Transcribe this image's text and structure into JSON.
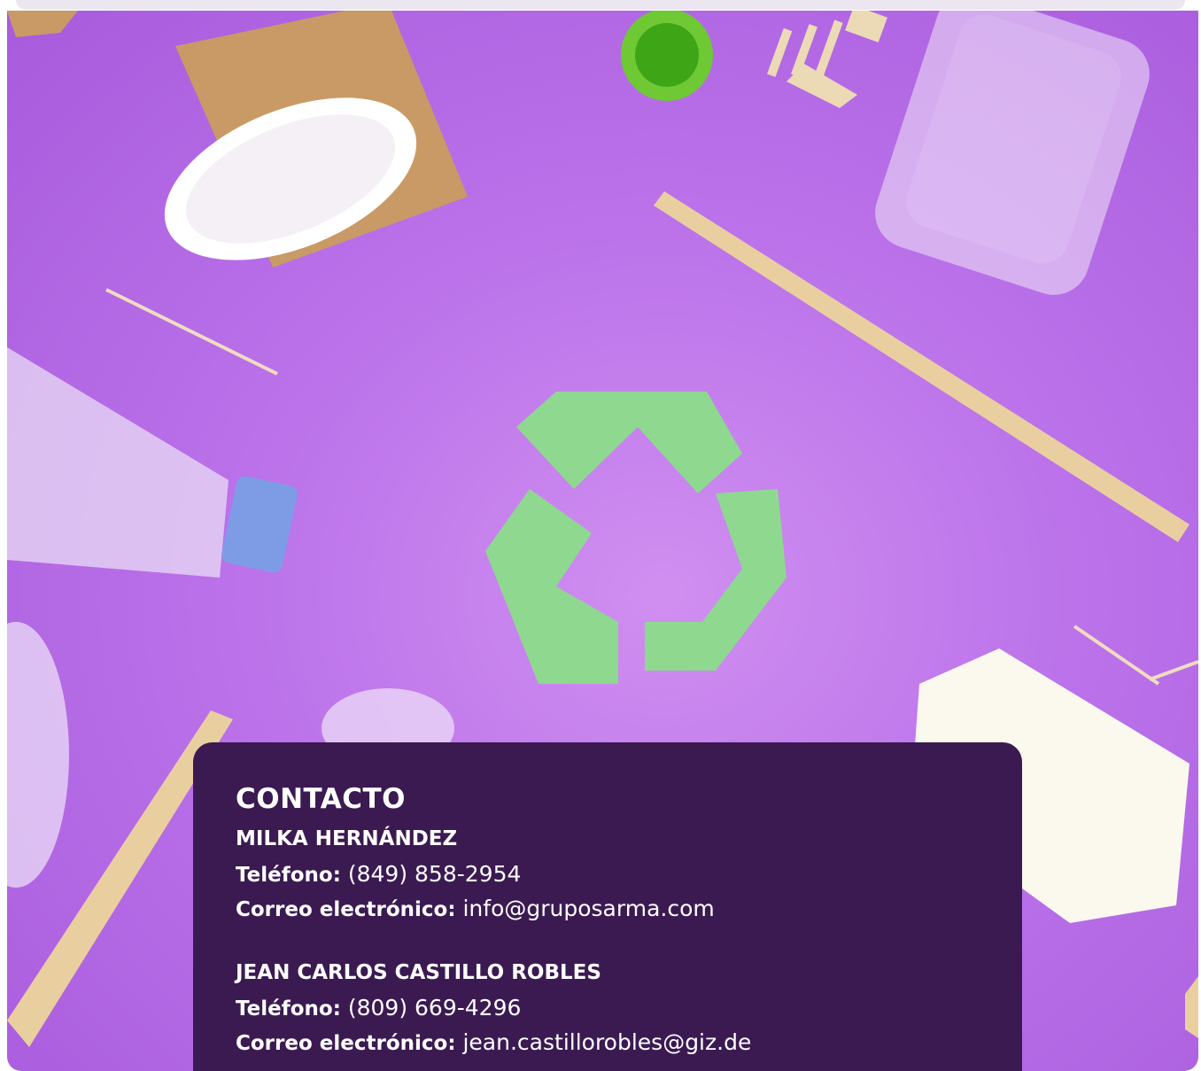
{
  "contact": {
    "title": "CONTACTO",
    "people": [
      {
        "name": "MILKA HERNÁNDEZ",
        "phone_label": "Teléfono:",
        "phone": "(849) 858-2954",
        "email_label": "Correo electrónico:",
        "email": "info@gruposarma.com"
      },
      {
        "name": "JEAN CARLOS CASTILLO ROBLES",
        "phone_label": "Teléfono:",
        "phone": "(809) 669-4296",
        "email_label": "Correo electrónico:",
        "email": "jean.castillorobles@giz.de"
      }
    ]
  },
  "colors": {
    "background_purple": "#bb72ea",
    "card": "#3b1a52",
    "recycle_green": "#8fd890",
    "text": "#ffffff"
  },
  "icons": [
    "recycle-icon"
  ]
}
